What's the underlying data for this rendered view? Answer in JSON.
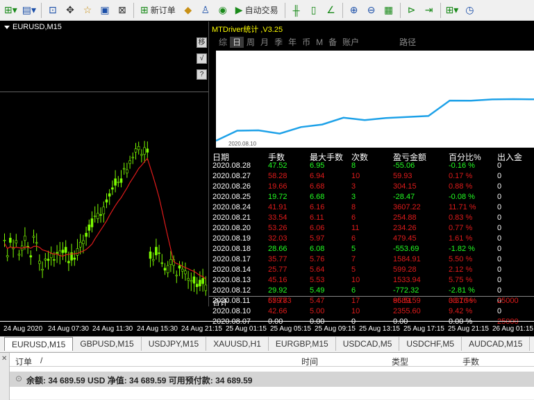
{
  "toolbar": {
    "new_order": "新订单",
    "auto_trading": "自动交易"
  },
  "chart": {
    "title": "EURUSD,M15",
    "side_buttons": [
      "移",
      "√",
      "?"
    ],
    "time_labels": [
      "24 Aug 2020",
      "24 Aug 07:30",
      "24 Aug 11:30",
      "24 Aug 15:30",
      "24 Aug 21:15",
      "25 Aug 01:15",
      "25 Aug 05:15",
      "25 Aug 09:15",
      "25 Aug 13:15",
      "25 Aug 17:15",
      "25 Aug 21:15",
      "26 Aug 01:15"
    ]
  },
  "panel": {
    "title": "MTDriver统计 ,V3.25",
    "tabs": [
      "综",
      "日",
      "周",
      "月",
      "季",
      "年",
      "币",
      "M",
      "备",
      "账户",
      "路径"
    ],
    "active_tab": "日",
    "curve_start_label": "2020.08.10",
    "columns": [
      "日期",
      "手数",
      "最大手数",
      "次数",
      "盈亏金额",
      "百分比%",
      "出入金"
    ],
    "rows": [
      {
        "date": "2020.08.28",
        "lots": "47.52",
        "max": "6.95",
        "count": "8",
        "pl": "-55.06",
        "pct": "-0.16 %",
        "flow": "0",
        "sign": "pos"
      },
      {
        "date": "2020.08.27",
        "lots": "58.28",
        "max": "6.94",
        "count": "10",
        "pl": "59.93",
        "pct": "0.17 %",
        "flow": "0",
        "sign": "neg"
      },
      {
        "date": "2020.08.26",
        "lots": "19.66",
        "max": "6.68",
        "count": "3",
        "pl": "304.15",
        "pct": "0.88 %",
        "flow": "0",
        "sign": "neg"
      },
      {
        "date": "2020.08.25",
        "lots": "19.72",
        "max": "6.68",
        "count": "3",
        "pl": "-28.47",
        "pct": "-0.08 %",
        "flow": "0",
        "sign": "pos"
      },
      {
        "date": "2020.08.24",
        "lots": "41.91",
        "max": "6.16",
        "count": "8",
        "pl": "3607.22",
        "pct": "11.71 %",
        "flow": "0",
        "sign": "neg"
      },
      {
        "date": "2020.08.21",
        "lots": "33.54",
        "max": "6.11",
        "count": "6",
        "pl": "254.88",
        "pct": "0.83 %",
        "flow": "0",
        "sign": "neg"
      },
      {
        "date": "2020.08.20",
        "lots": "53.26",
        "max": "6.06",
        "count": "11",
        "pl": "234.26",
        "pct": "0.77 %",
        "flow": "0",
        "sign": "neg"
      },
      {
        "date": "2020.08.19",
        "lots": "32.03",
        "max": "5.97",
        "count": "6",
        "pl": "479.45",
        "pct": "1.61 %",
        "flow": "0",
        "sign": "neg"
      },
      {
        "date": "2020.08.18",
        "lots": "28.66",
        "max": "6.08",
        "count": "5",
        "pl": "-553.69",
        "pct": "-1.82 %",
        "flow": "0",
        "sign": "pos"
      },
      {
        "date": "2020.08.17",
        "lots": "35.77",
        "max": "5.76",
        "count": "7",
        "pl": "1584.91",
        "pct": "5.50 %",
        "flow": "0",
        "sign": "neg"
      },
      {
        "date": "2020.08.14",
        "lots": "25.77",
        "max": "5.64",
        "count": "5",
        "pl": "599.28",
        "pct": "2.12 %",
        "flow": "0",
        "sign": "neg"
      },
      {
        "date": "2020.08.13",
        "lots": "45.16",
        "max": "5.53",
        "count": "10",
        "pl": "1533.94",
        "pct": "5.75 %",
        "flow": "0",
        "sign": "neg"
      },
      {
        "date": "2020.08.12",
        "lots": "29.92",
        "max": "5.49",
        "count": "6",
        "pl": "-772.32",
        "pct": "-2.81 %",
        "flow": "0",
        "sign": "pos"
      },
      {
        "date": "2020.08.11",
        "lots": "65.77",
        "max": "5.47",
        "count": "17",
        "pl": "85.51",
        "pct": "0.31 %",
        "flow": "0",
        "sign": "neg"
      },
      {
        "date": "2020.08.10",
        "lots": "42.66",
        "max": "5.00",
        "count": "10",
        "pl": "2355.60",
        "pct": "9.42 %",
        "flow": "0",
        "sign": "neg"
      },
      {
        "date": "2020.08.07",
        "lots": "0.00",
        "max": "0.00",
        "count": "0",
        "pl": "0.00",
        "pct": "0.00 %",
        "flow": "25000",
        "sign": "wht"
      }
    ],
    "total": {
      "label": "合计",
      "lots": "579.83",
      "pl": "9689.59",
      "pct": "38.76 %",
      "flow": "25000"
    }
  },
  "chart_tabs": [
    "EURUSD,M15",
    "GBPUSD,M15",
    "USDJPY,M15",
    "XAUUSD,H1",
    "EURGBP,M15",
    "USDCAD,M5",
    "USDCHF,M5",
    "AUDCAD,M15"
  ],
  "terminal": {
    "columns": [
      "订单",
      "/",
      "时间",
      "类型",
      "手数"
    ],
    "balance_line": "余额: 34 689.59 USD  净值: 34 689.59  可用预付款: 34 689.59"
  },
  "colors": {
    "chart_bg": "#000000",
    "candle_up": "#7cfc00",
    "ma": "#e01b1b",
    "equity_curve": "#1da1e8",
    "title_yellow": "#ffff00"
  }
}
